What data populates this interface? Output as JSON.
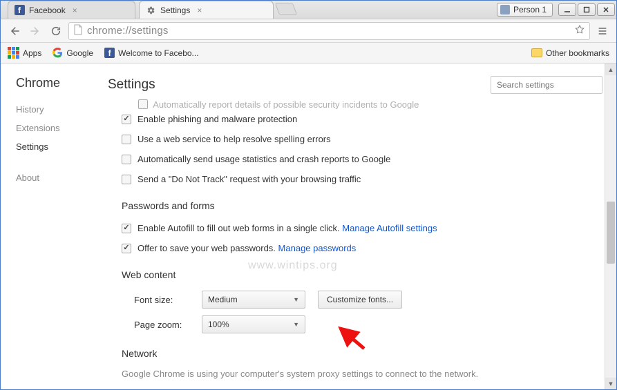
{
  "window": {
    "profile": "Person 1",
    "tabs": [
      {
        "label": "Facebook",
        "active": false
      },
      {
        "label": "Settings",
        "active": true
      }
    ]
  },
  "toolbar": {
    "url": "chrome://settings"
  },
  "bookmarks": {
    "apps": "Apps",
    "google": "Google",
    "fb": "Welcome to Facebo...",
    "other": "Other bookmarks"
  },
  "sidebar": {
    "title": "Chrome",
    "items": [
      {
        "label": "History"
      },
      {
        "label": "Extensions"
      },
      {
        "label": "Settings"
      },
      {
        "label": "About"
      }
    ]
  },
  "main": {
    "title": "Settings",
    "search_placeholder": "Search settings",
    "truncated": "Automatically report details of possible security incidents to Google",
    "privacy": {
      "phishing": "Enable phishing and malware protection",
      "spelling": "Use a web service to help resolve spelling errors",
      "usage": "Automatically send usage statistics and crash reports to Google",
      "dnt": "Send a \"Do Not Track\" request with your browsing traffic"
    },
    "passwords": {
      "heading": "Passwords and forms",
      "autofill_text": "Enable Autofill to fill out web forms in a single click.",
      "autofill_link": "Manage Autofill settings",
      "save_text": "Offer to save your web passwords.",
      "save_link": "Manage passwords"
    },
    "webcontent": {
      "heading": "Web content",
      "font_label": "Font size:",
      "font_value": "Medium",
      "customize": "Customize fonts...",
      "zoom_label": "Page zoom:",
      "zoom_value": "100%"
    },
    "network": {
      "heading": "Network",
      "text": "Google Chrome is using your computer's system proxy settings to connect to the network."
    }
  },
  "watermark": "www.wintips.org"
}
